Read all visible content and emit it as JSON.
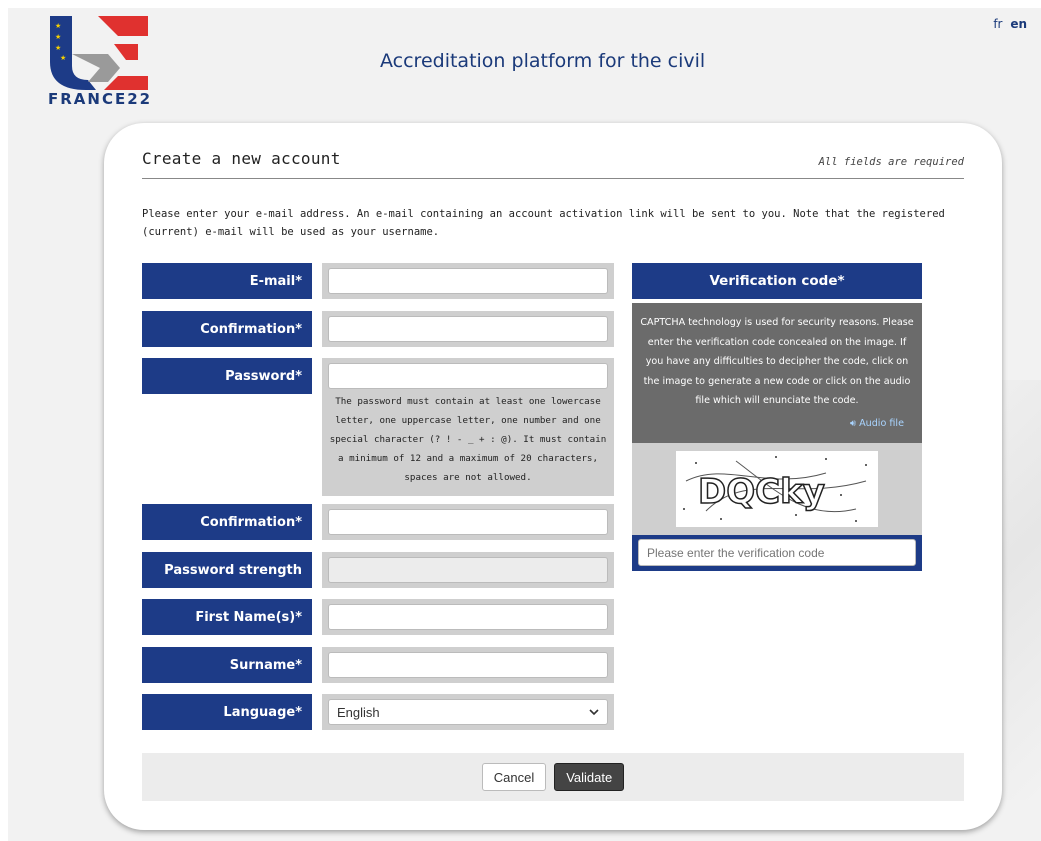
{
  "header": {
    "logo_text": "FRANCE22",
    "site_title": "Accreditation platform for the civil",
    "languages": [
      "fr",
      "en"
    ],
    "active_language": "en"
  },
  "card": {
    "title": "Create a new account",
    "fields_note": "All fields are required",
    "intro": "Please enter your e-mail address. An e-mail containing an account activation link will be sent to you. Note that the registered (current) e-mail will be used as your username."
  },
  "form": {
    "email_label": "E-mail*",
    "email_confirm_label": "Confirmation*",
    "password_label": "Password*",
    "password_help": "The password must contain at least one lowercase letter, one uppercase letter, one number and one special character (? ! - _ + : @). It must contain a minimum of 12 and a maximum of 20 characters, spaces are not allowed.",
    "password_confirm_label": "Confirmation*",
    "strength_label": "Password strength",
    "first_name_label": "First Name(s)*",
    "surname_label": "Surname*",
    "language_label": "Language*",
    "language_value": "English"
  },
  "captcha": {
    "title": "Verification code*",
    "description": "CAPTCHA technology is used for security reasons. Please enter the verification code concealed on the image. If you have any difficulties to decipher the code, click on the image to generate a new code or click on the audio file which will enunciate the code.",
    "audio_label": "Audio file",
    "image_text": "DQCky",
    "input_placeholder": "Please enter the verification code"
  },
  "actions": {
    "cancel_label": "Cancel",
    "validate_label": "Validate"
  },
  "colors": {
    "brand_blue": "#1d3b87",
    "brand_red": "#e0312f",
    "label_bg": "#1d3b87",
    "captcha_desc_bg": "#6b6b6b"
  }
}
